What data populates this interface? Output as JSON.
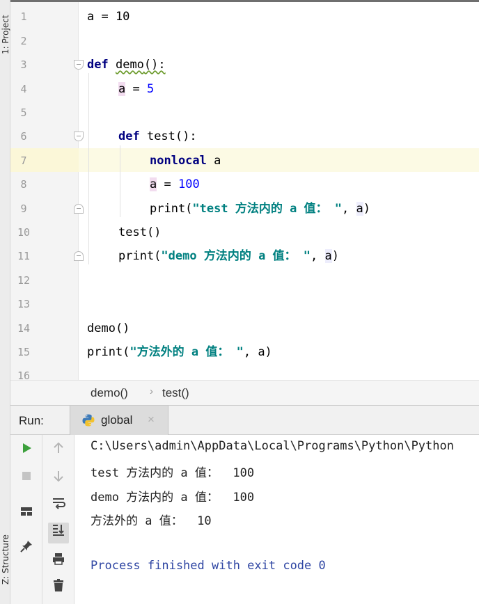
{
  "side_tabs": {
    "project": "1: Project",
    "structure": "Z: Structure"
  },
  "editor": {
    "line_numbers": [
      "1",
      "2",
      "3",
      "4",
      "5",
      "6",
      "7",
      "8",
      "9",
      "10",
      "11",
      "12",
      "13",
      "14",
      "15",
      "16"
    ],
    "code": {
      "l1": "a = 10",
      "l3_def": "def",
      "l3_name": "demo",
      "l3_rest": "():",
      "l4_var": "a",
      "l4_eq": " = ",
      "l4_num": "5",
      "l6_def": "def",
      "l6_rest": " test():",
      "l7_kw": "nonlocal",
      "l7_var": " a",
      "l8_var": "a",
      "l8_eq": " = ",
      "l8_num": "100",
      "l9_fn": "print(",
      "l9_str": "\"test 方法内的 a 值： \"",
      "l9_sep": ", ",
      "l9_var": "a",
      "l9_end": ")",
      "l10": "test()",
      "l11_fn": "print(",
      "l11_str": "\"demo 方法内的 a 值： \"",
      "l11_sep": ", ",
      "l11_var": "a",
      "l11_end": ")",
      "l14": "demo()",
      "l15_fn": "print(",
      "l15_str": "\"方法外的 a 值： \"",
      "l15_rest": ", a)"
    }
  },
  "breadcrumb": {
    "items": [
      "demo()",
      "test()"
    ],
    "separator": "›"
  },
  "run_panel": {
    "label": "Run:",
    "tab_title": "global",
    "tab_close": "×",
    "console_lines": [
      "C:\\Users\\admin\\AppData\\Local\\Programs\\Python\\Python",
      "test 方法内的 a 值：  100",
      "demo 方法内的 a 值：  100",
      "方法外的 a 值：  10",
      "",
      "Process finished with exit code 0"
    ]
  },
  "icons": {
    "run": "play-icon",
    "stop": "stop-icon",
    "layout": "layout-icon",
    "pin": "pin-icon",
    "up": "arrow-up-icon",
    "down": "arrow-down-icon",
    "wrap": "soft-wrap-icon",
    "scroll": "scroll-to-end-icon",
    "print": "print-icon",
    "trash": "trash-icon"
  },
  "colors": {
    "keyword": "#000080",
    "number": "#0000ff",
    "string": "#008080",
    "run_green": "#3ca03c"
  }
}
